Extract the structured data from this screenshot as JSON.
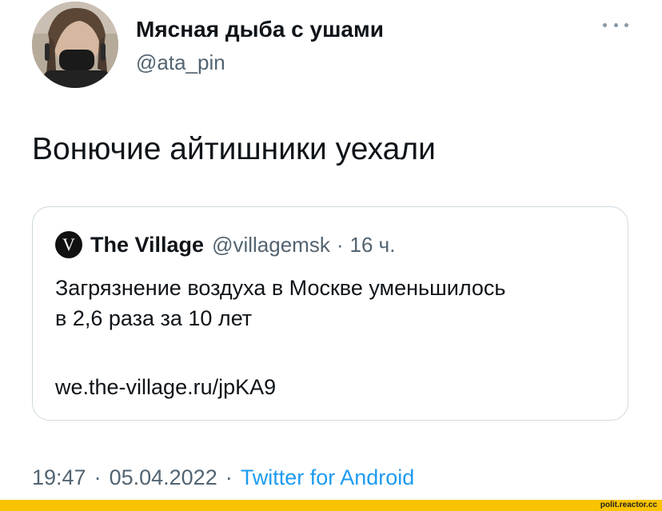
{
  "author": {
    "display_name": "Мясная дыба с ушами",
    "handle": "@ata_pin"
  },
  "menu": {
    "icon": "more-horizontal-icon"
  },
  "tweet": {
    "text": "Вонючие айтишники уехали"
  },
  "quote": {
    "logo_letter": "V",
    "name": "The Village",
    "handle": "@villagemsk",
    "separator": "·",
    "time": "16 ч.",
    "text_lines": [
      "Загрязнение воздуха в Москве уменьшилось",
      "в 2,6 раза за 10 лет"
    ],
    "link": "we.the-village.ru/jpKA9"
  },
  "meta": {
    "time": "19:47",
    "separator": "·",
    "date": "05.04.2022",
    "source": "Twitter for Android"
  },
  "watermark": {
    "text": "polit.reactor.cc"
  },
  "colors": {
    "link_blue": "#1d9bf0",
    "secondary_text": "#536471",
    "border": "#cfd9de",
    "watermark_yellow": "#f9c300"
  }
}
